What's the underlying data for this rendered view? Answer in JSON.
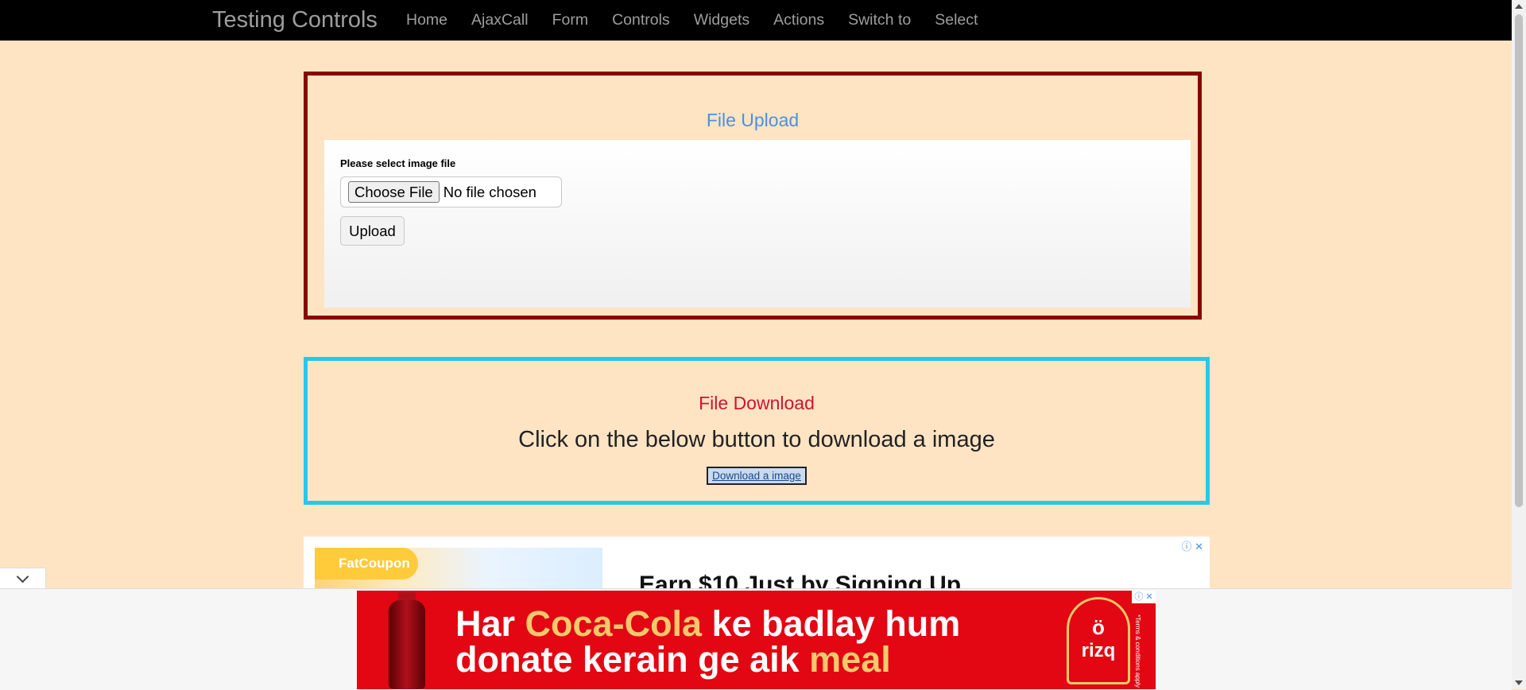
{
  "navbar": {
    "brand": "Testing Controls",
    "items": [
      "Home",
      "AjaxCall",
      "Form",
      "Controls",
      "Widgets",
      "Actions",
      "Switch to",
      "Select"
    ]
  },
  "upload": {
    "title": "File Upload",
    "label": "Please select image file",
    "choose_label": "Choose File",
    "file_status": "No file chosen",
    "upload_label": "Upload"
  },
  "download": {
    "title": "File Download",
    "description": "Click on the below button to download a image",
    "link_label": "Download a image"
  },
  "ads": {
    "top_logo": "FatCoupon",
    "top_headline": "Earn $10 Just by Signing Up",
    "top_info": "ⓘ ✕",
    "banner_line1_a": "Har ",
    "banner_line1_b": "Coca-Cola",
    "banner_line1_c": " ke badlay hum",
    "banner_line2_a": "donate kerain ge aik ",
    "banner_line2_b": "meal",
    "banner_logo_text": "rizq",
    "banner_fine": "*Terms & conditions apply",
    "banner_close": "ⓘ ✕"
  },
  "colors": {
    "page_bg": "#ffe4c4",
    "upload_border": "#8b0000",
    "download_border": "#29c7ea",
    "upload_title": "#4a90e2",
    "download_title": "#d2122e"
  }
}
